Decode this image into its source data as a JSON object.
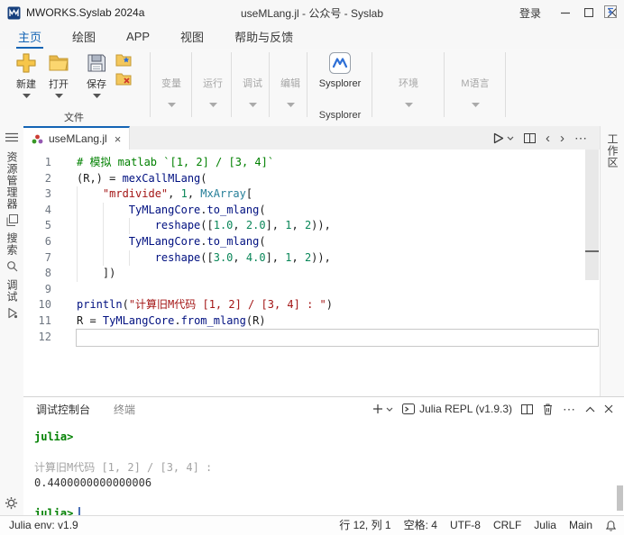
{
  "title_bar": {
    "app_name": "MWORKS.Syslab 2024a",
    "window_title": "useMLang.jl - 公众号 - Syslab",
    "login_label": "登录"
  },
  "menu": {
    "tabs": [
      "主页",
      "绘图",
      "APP",
      "视图",
      "帮助与反馈"
    ],
    "active_tab": "主页"
  },
  "ribbon": {
    "buttons": [
      {
        "label": "新建"
      },
      {
        "label": "打开"
      },
      {
        "label": "保存"
      }
    ],
    "file_group_label": "文件",
    "groups": [
      "变量",
      "运行",
      "调试",
      "编辑"
    ],
    "sysplorer_label": "Sysplorer",
    "sysplorer_group_label": "Sysplorer",
    "right_groups": [
      "环境",
      "M语言"
    ]
  },
  "activity_bar": {
    "items": [
      {
        "label": "资源管理器"
      },
      {
        "label": "搜索"
      },
      {
        "label": "调试"
      }
    ]
  },
  "right_bar": {
    "label": "工作区"
  },
  "editor": {
    "tab_title": "useMLang.jl",
    "current_line": 12,
    "lines": [
      {
        "g": 0,
        "segs": [
          [
            "cm",
            "# 模拟 matlab `[1, 2] / [3, 4]`"
          ]
        ]
      },
      {
        "g": 0,
        "segs": [
          [
            "pl",
            "(R,) = "
          ],
          [
            "fn",
            "mexCallMLang"
          ],
          [
            "pl",
            "("
          ]
        ]
      },
      {
        "g": 1,
        "segs": [
          [
            "pl",
            "    "
          ],
          [
            "str",
            "\"mrdivide\""
          ],
          [
            "pl",
            ", "
          ],
          [
            "num",
            "1"
          ],
          [
            "pl",
            ", "
          ],
          [
            "ty",
            "MxArray"
          ],
          [
            "pl",
            "["
          ]
        ]
      },
      {
        "g": 2,
        "segs": [
          [
            "pl",
            "        "
          ],
          [
            "fn",
            "TyMLangCore"
          ],
          [
            "pl",
            "."
          ],
          [
            "fn",
            "to_mlang"
          ],
          [
            "pl",
            "("
          ]
        ]
      },
      {
        "g": 3,
        "segs": [
          [
            "pl",
            "            "
          ],
          [
            "fn",
            "reshape"
          ],
          [
            "pl",
            "(["
          ],
          [
            "num",
            "1.0"
          ],
          [
            "pl",
            ", "
          ],
          [
            "num",
            "2.0"
          ],
          [
            "pl",
            "], "
          ],
          [
            "num",
            "1"
          ],
          [
            "pl",
            ", "
          ],
          [
            "num",
            "2"
          ],
          [
            "pl",
            ")),"
          ]
        ]
      },
      {
        "g": 2,
        "segs": [
          [
            "pl",
            "        "
          ],
          [
            "fn",
            "TyMLangCore"
          ],
          [
            "pl",
            "."
          ],
          [
            "fn",
            "to_mlang"
          ],
          [
            "pl",
            "("
          ]
        ]
      },
      {
        "g": 3,
        "segs": [
          [
            "pl",
            "            "
          ],
          [
            "fn",
            "reshape"
          ],
          [
            "pl",
            "(["
          ],
          [
            "num",
            "3.0"
          ],
          [
            "pl",
            ", "
          ],
          [
            "num",
            "4.0"
          ],
          [
            "pl",
            "], "
          ],
          [
            "num",
            "1"
          ],
          [
            "pl",
            ", "
          ],
          [
            "num",
            "2"
          ],
          [
            "pl",
            ")),"
          ]
        ]
      },
      {
        "g": 1,
        "segs": [
          [
            "pl",
            "    ])"
          ]
        ]
      },
      {
        "g": 0,
        "segs": []
      },
      {
        "g": 0,
        "segs": [
          [
            "fn",
            "println"
          ],
          [
            "pl",
            "("
          ],
          [
            "str",
            "\"计算旧M代码 [1, 2] / [3, 4] : \""
          ],
          [
            "pl",
            ")"
          ]
        ]
      },
      {
        "g": 0,
        "segs": [
          [
            "pl",
            "R = "
          ],
          [
            "fn",
            "TyMLangCore"
          ],
          [
            "pl",
            "."
          ],
          [
            "fn",
            "from_mlang"
          ],
          [
            "pl",
            "(R)"
          ]
        ]
      },
      {
        "g": 0,
        "segs": []
      }
    ]
  },
  "panel": {
    "tabs": [
      "调试控制台",
      "终端"
    ],
    "active_tab": "调试控制台",
    "repl_selector": "Julia REPL (v1.9.3)",
    "console": [
      {
        "kind": "prompt",
        "text": "julia>"
      },
      {
        "kind": "blank",
        "text": ""
      },
      {
        "kind": "dim",
        "text": "计算旧M代码 [1, 2] / [3, 4] : "
      },
      {
        "kind": "out",
        "text": "0.4400000000000006"
      },
      {
        "kind": "blank",
        "text": ""
      },
      {
        "kind": "prompt",
        "text": "julia>",
        "cursor": true
      }
    ]
  },
  "status_bar": {
    "left": "Julia env: v1.9",
    "items": [
      "行 12, 列 1",
      "空格: 4",
      "UTF-8",
      "CRLF",
      "Julia",
      "Main"
    ]
  },
  "colors": {
    "accent": "#1464b4",
    "prompt_green": "#008000",
    "tokens": {
      "pl": "#1b1b1b",
      "cm": "#008000",
      "str": "#a31515",
      "num": "#098658",
      "fn": "#001080",
      "ty": "#267f99"
    }
  }
}
